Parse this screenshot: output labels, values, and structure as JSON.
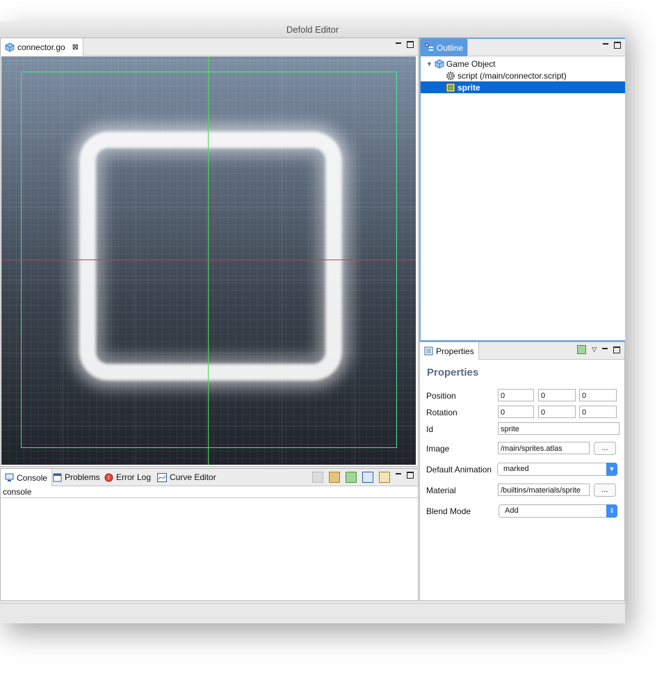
{
  "window": {
    "title": "Defold Editor"
  },
  "editor": {
    "tab_label": "connector.go",
    "tab_icon": "game-object-cube-icon"
  },
  "console": {
    "tabs": [
      {
        "label": "Console",
        "icon": "monitor-icon"
      },
      {
        "label": "Problems",
        "icon": "problems-icon"
      },
      {
        "label": "Error Log",
        "icon": "error-log-icon"
      },
      {
        "label": "Curve Editor",
        "icon": "curve-icon"
      }
    ],
    "subheader": "console"
  },
  "outline": {
    "tab_label": "Outline",
    "tree": [
      {
        "label": "Game Object",
        "icon": "game-object-cube-icon",
        "level": 0
      },
      {
        "label": "script (/main/connector.script)",
        "icon": "gear-icon",
        "level": 1
      },
      {
        "label": "sprite",
        "icon": "sprite-icon",
        "level": 1,
        "selected": true
      }
    ]
  },
  "properties": {
    "tab_label": "Properties",
    "heading": "Properties",
    "position": {
      "label": "Position",
      "values": [
        "0",
        "0",
        "0"
      ]
    },
    "rotation": {
      "label": "Rotation",
      "values": [
        "0",
        "0",
        "0"
      ]
    },
    "id": {
      "label": "Id",
      "value": "sprite"
    },
    "image": {
      "label": "Image",
      "value": "/main/sprites.atlas",
      "button": "..."
    },
    "default_animation": {
      "label": "Default Animation",
      "value": "marked"
    },
    "material": {
      "label": "Material",
      "value": "/builtins/materials/sprite",
      "button": "..."
    },
    "blend_mode": {
      "label": "Blend Mode",
      "value": "Add"
    }
  },
  "colors": {
    "selection": "#0a68d2",
    "focus_border": "#6ea3d8",
    "props_heading": "#5a6b80",
    "select_arrow": "#3d8df5",
    "guide_green": "#3fd84a",
    "guide_red": "#d23a3a"
  }
}
